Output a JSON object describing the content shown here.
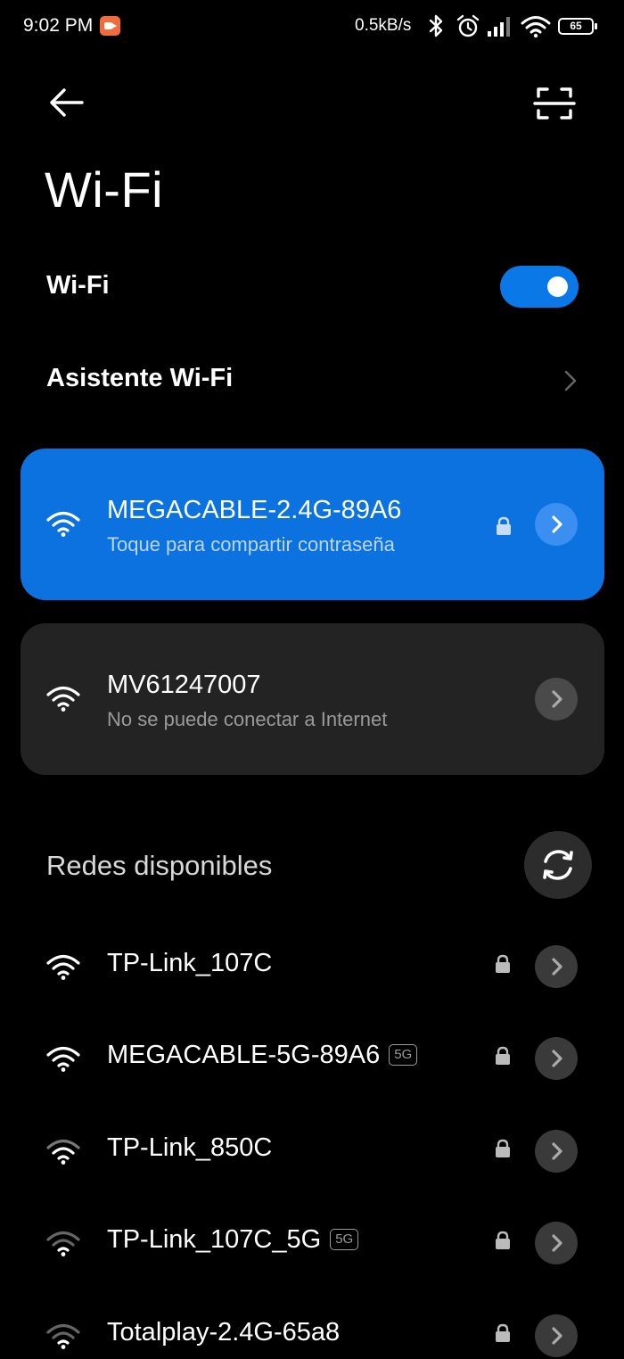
{
  "status_bar": {
    "time": "9:02 PM",
    "speed": "0.5kB/s",
    "battery": "65"
  },
  "header": {
    "title": "Wi-Fi"
  },
  "wifi_toggle": {
    "label": "Wi-Fi",
    "on": true
  },
  "assistant": {
    "label": "Asistente Wi-Fi"
  },
  "saved_networks": [
    {
      "ssid": "MEGACABLE-2.4G-89A6",
      "subtitle": "Toque para compartir contraseña",
      "secured": true,
      "connected": true
    },
    {
      "ssid": "MV61247007",
      "subtitle": "No se puede conectar a Internet",
      "secured": false,
      "connected": false
    }
  ],
  "available": {
    "title": "Redes disponibles",
    "networks": [
      {
        "ssid": "TP-Link_107C",
        "badge": "",
        "secured": true
      },
      {
        "ssid": "MEGACABLE-5G-89A6",
        "badge": "5G",
        "secured": true
      },
      {
        "ssid": "TP-Link_850C",
        "badge": "",
        "secured": true
      },
      {
        "ssid": "TP-Link_107C_5G",
        "badge": "5G",
        "secured": true
      },
      {
        "ssid": "Totalplay-2.4G-65a8",
        "badge": "",
        "secured": true
      }
    ]
  },
  "colors": {
    "accent": "#0b72e0",
    "background": "#000000",
    "card": "#232323"
  }
}
